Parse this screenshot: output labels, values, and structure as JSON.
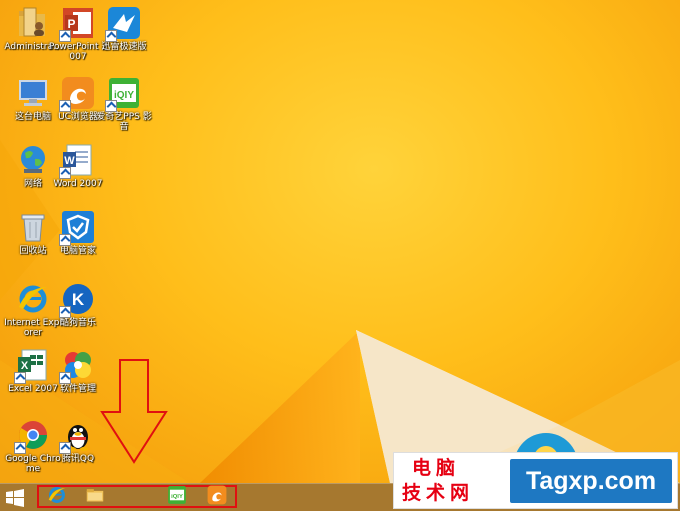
{
  "desktop": {
    "icons": [
      {
        "name": "administrator-folder",
        "label": "Administra...",
        "glyph": "user-folder-icon",
        "shortcut": false
      },
      {
        "name": "powerpoint-2007",
        "label": "PowerPoint 2007",
        "glyph": "powerpoint-icon",
        "shortcut": true
      },
      {
        "name": "xunlei-speed",
        "label": "迅雷极速版",
        "glyph": "bird-icon",
        "shortcut": true
      },
      {
        "name": "this-pc",
        "label": "这台电脑",
        "glyph": "computer-icon",
        "shortcut": false
      },
      {
        "name": "uc-browser",
        "label": "UC浏览器",
        "glyph": "uc-squirrel-icon",
        "shortcut": true
      },
      {
        "name": "iqiyi-pps",
        "label": "爱奇艺PPS 影音",
        "glyph": "iqiyi-icon",
        "shortcut": true
      },
      {
        "name": "network",
        "label": "网络",
        "glyph": "globe-icon",
        "shortcut": false
      },
      {
        "name": "word-2007",
        "label": "Word 2007",
        "glyph": "word-icon",
        "shortcut": true
      },
      {
        "name": "recycle-bin",
        "label": "回收站",
        "glyph": "recycle-bin-icon",
        "shortcut": false
      },
      {
        "name": "pc-manager",
        "label": "电脑管家",
        "glyph": "shield-icon",
        "shortcut": true
      },
      {
        "name": "internet-explorer",
        "label": "Internet Explorer",
        "glyph": "ie-icon",
        "shortcut": false
      },
      {
        "name": "kugou-music",
        "label": "酷狗音乐",
        "glyph": "kugou-icon",
        "shortcut": true
      },
      {
        "name": "excel-2007",
        "label": "Excel 2007",
        "glyph": "excel-icon",
        "shortcut": true
      },
      {
        "name": "software-manager",
        "label": "软件管理",
        "glyph": "software-manager-icon",
        "shortcut": true
      },
      {
        "name": "google-chrome",
        "label": "Google Chrome",
        "glyph": "chrome-icon",
        "shortcut": true
      },
      {
        "name": "tencent-qq",
        "label": "腾讯QQ",
        "glyph": "qq-penguin-icon",
        "shortcut": true
      }
    ]
  },
  "taskbar": {
    "start_icon": "windows-logo-icon",
    "pinned": [
      {
        "name": "ie",
        "icon": "ie-icon"
      },
      {
        "name": "file-explorer",
        "icon": "folder-icon"
      },
      {
        "name": "iqiyi",
        "icon": "iqiyi-icon"
      },
      {
        "name": "uc-browser",
        "icon": "uc-squirrel-icon"
      }
    ]
  },
  "watermark": {
    "line1": "电脑",
    "line2": "技术网",
    "domain": "Tagxp.com"
  },
  "colors": {
    "highlight_red": "#e01010",
    "watermark_red": "#e60012",
    "watermark_blue": "#1e78c2"
  }
}
